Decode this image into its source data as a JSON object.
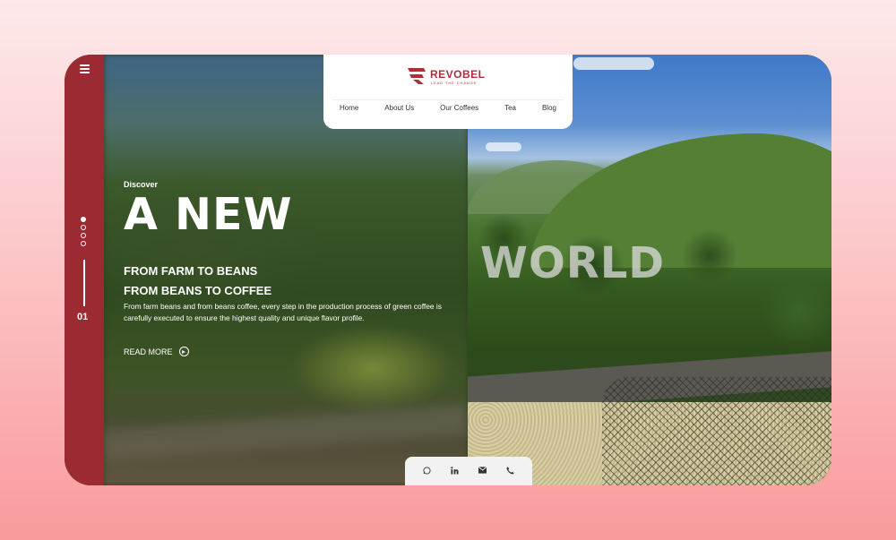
{
  "brand": {
    "name": "REVOBEL",
    "tagline": "LEAD THE CHANGE",
    "color": "#b32d36"
  },
  "nav": {
    "items": [
      "Home",
      "About Us",
      "Our Coffees",
      "Tea",
      "Blog"
    ]
  },
  "hero": {
    "discover": "Discover",
    "headline_left": "A NEW",
    "headline_right": "WORLD",
    "subline1": "FROM FARM TO BEANS",
    "subline2": "FROM BEANS TO COFFEE",
    "description": "From farm beans and from beans coffee, every step in the production process of green coffee is carefully executed to ensure the highest quality and unique flavor profile.",
    "read_more": "READ MORE"
  },
  "slider": {
    "current": "01",
    "total_dots": 4,
    "active_dot": 1,
    "rail_color": "#9b2a32"
  },
  "social": {
    "icons": [
      "whatsapp-icon",
      "linkedin-icon",
      "email-icon",
      "phone-icon"
    ]
  },
  "icons": {
    "menu": "hamburger-menu-icon",
    "read_more": "arrow-circle-icon"
  }
}
